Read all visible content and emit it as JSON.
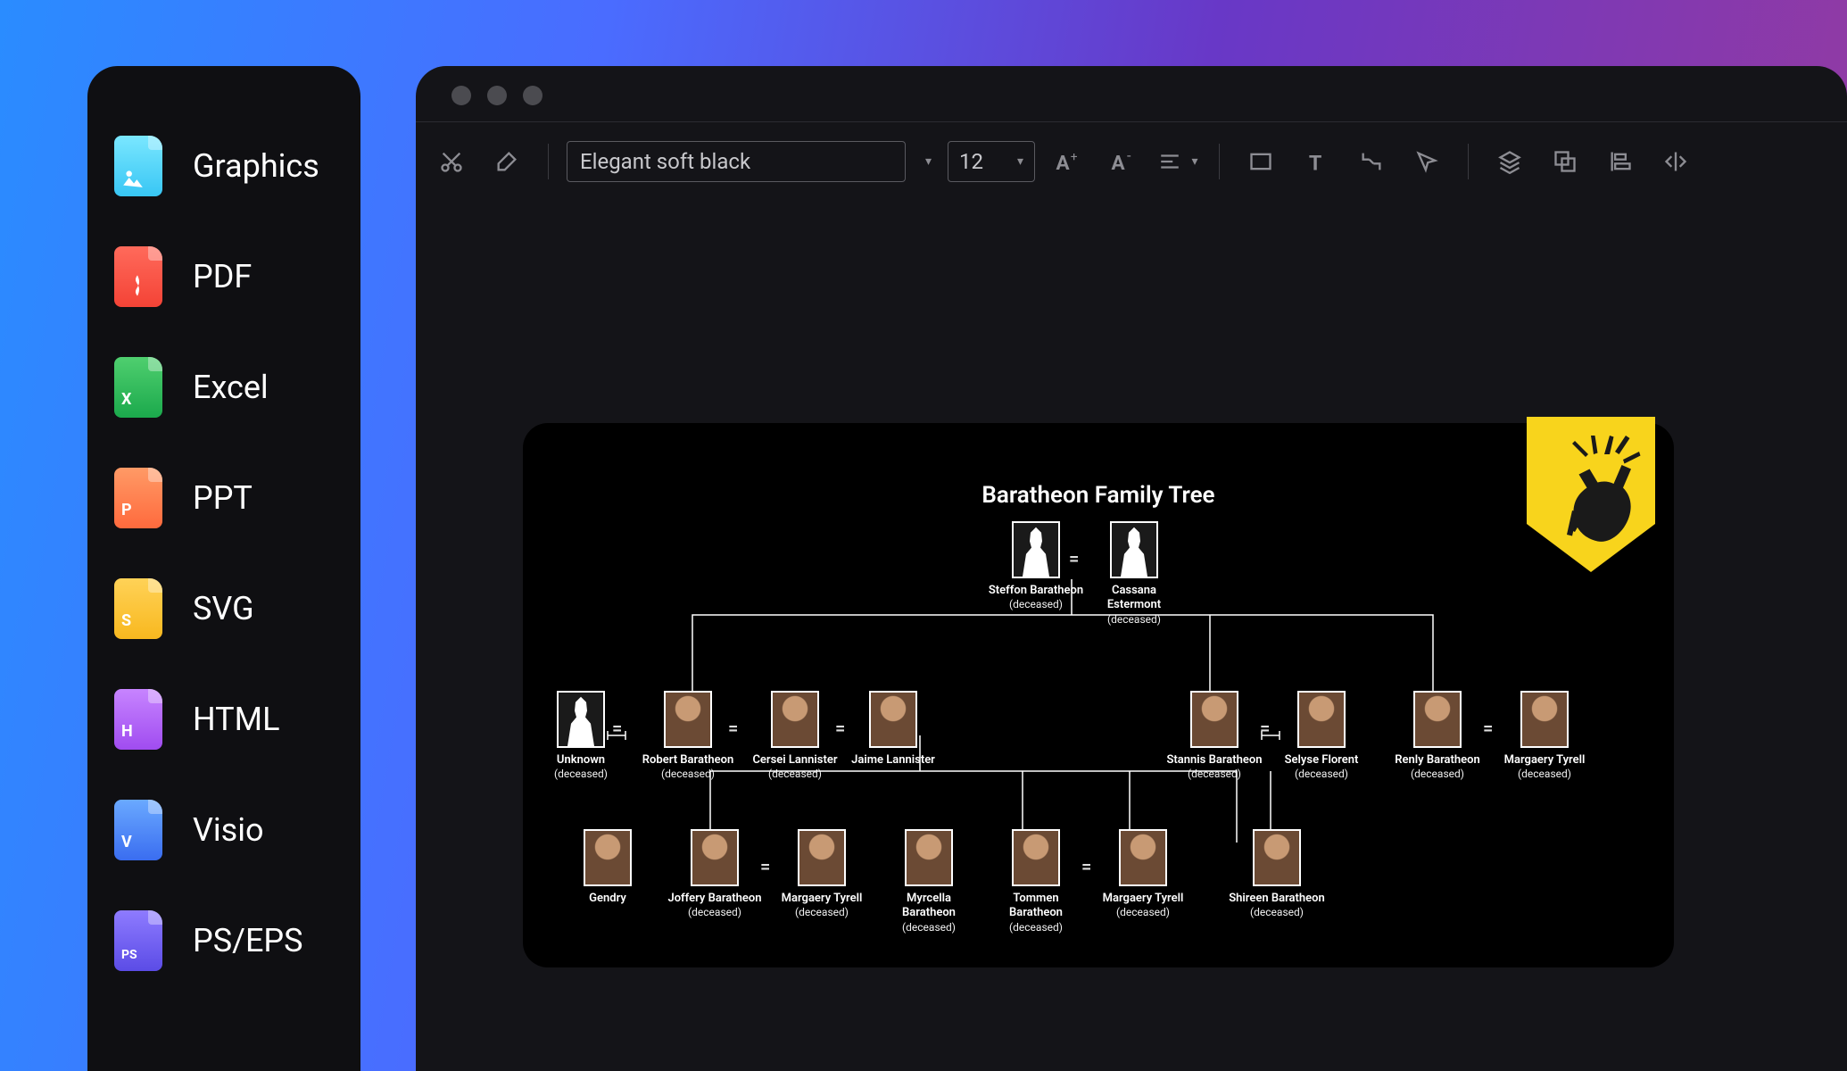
{
  "sidebar": {
    "items": [
      {
        "label": "Graphics",
        "icon": "image-file-icon",
        "color": "teal",
        "tag": ""
      },
      {
        "label": "PDF",
        "icon": "pdf-file-icon",
        "color": "red",
        "tag": ""
      },
      {
        "label": "Excel",
        "icon": "excel-file-icon",
        "color": "green",
        "tag": "X"
      },
      {
        "label": "PPT",
        "icon": "ppt-file-icon",
        "color": "orange",
        "tag": "P"
      },
      {
        "label": "SVG",
        "icon": "svg-file-icon",
        "color": "yellow",
        "tag": "S"
      },
      {
        "label": "HTML",
        "icon": "html-file-icon",
        "color": "purple",
        "tag": "H"
      },
      {
        "label": "Visio",
        "icon": "visio-file-icon",
        "color": "blue",
        "tag": "V"
      },
      {
        "label": "PS/EPS",
        "icon": "ps-file-icon",
        "color": "indigo",
        "tag": "PS"
      }
    ]
  },
  "toolbar": {
    "font_name": "Elegant soft black",
    "font_size": "12"
  },
  "diagram": {
    "title": "Baratheon Family Tree",
    "crest": "baratheon-stag-crest",
    "people": {
      "steffon": {
        "name": "Steffon Baratheon",
        "status": "(deceased)"
      },
      "cassana": {
        "name": "Cassana Estermont",
        "status": "(deceased)"
      },
      "unknown": {
        "name": "Unknown",
        "status": "(deceased)"
      },
      "robert": {
        "name": "Robert Baratheon",
        "status": "(deceased)"
      },
      "cersei": {
        "name": "Cersei Lannister",
        "status": "(deceased)"
      },
      "jaime": {
        "name": "Jaime Lannister",
        "status": ""
      },
      "stannis": {
        "name": "Stannis Baratheon",
        "status": "(deceased)"
      },
      "selyse": {
        "name": "Selyse Florent",
        "status": "(deceased)"
      },
      "renly": {
        "name": "Renly Baratheon",
        "status": "(deceased)"
      },
      "margaery1": {
        "name": "Margaery Tyrell",
        "status": "(deceased)"
      },
      "gendry": {
        "name": "Gendry",
        "status": ""
      },
      "joffery": {
        "name": "Joffery Baratheon",
        "status": "(deceased)"
      },
      "margaery2": {
        "name": "Margaery Tyrell",
        "status": "(deceased)"
      },
      "myrcella": {
        "name": "Myrcella Baratheon",
        "status": "(deceased)"
      },
      "tommen": {
        "name": "Tommen Baratheon",
        "status": "(deceased)"
      },
      "margaery3": {
        "name": "Margaery  Tyrell",
        "status": "(deceased)"
      },
      "shireen": {
        "name": "Shireen Baratheon",
        "status": "(deceased)"
      }
    }
  }
}
